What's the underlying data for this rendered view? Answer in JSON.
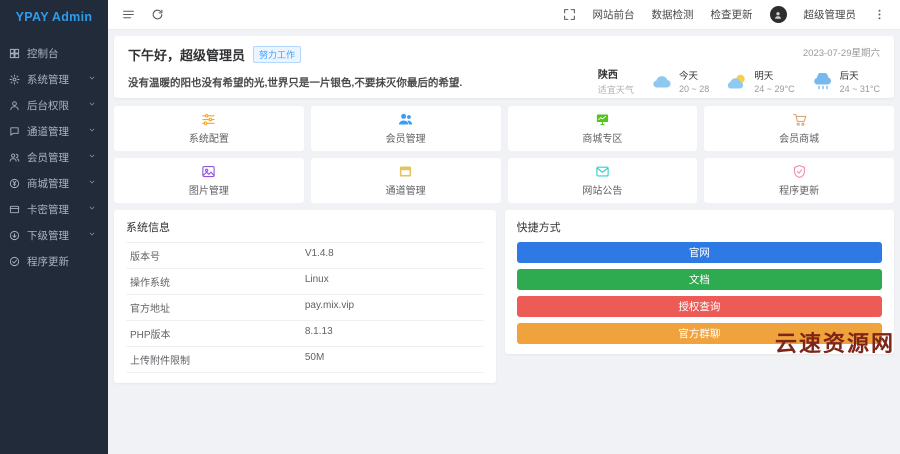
{
  "app": {
    "logo": "YPAY Admin"
  },
  "sidebar": {
    "items": [
      {
        "id": "dashboard",
        "label": "控制台",
        "icon": "dashboard-icon",
        "expandable": false
      },
      {
        "id": "system",
        "label": "系统管理",
        "icon": "gear-icon",
        "expandable": true
      },
      {
        "id": "admin-perms",
        "label": "后台权限",
        "icon": "user-icon",
        "expandable": true
      },
      {
        "id": "channel",
        "label": "通道管理",
        "icon": "chat-icon",
        "expandable": true
      },
      {
        "id": "member",
        "label": "会员管理",
        "icon": "users-icon",
        "expandable": true
      },
      {
        "id": "mall",
        "label": "商城管理",
        "icon": "yen-circle-icon",
        "expandable": true
      },
      {
        "id": "card-keys",
        "label": "卡密管理",
        "icon": "card-icon",
        "expandable": true
      },
      {
        "id": "subordinate",
        "label": "下级管理",
        "icon": "arrow-down-circle-icon",
        "expandable": true
      },
      {
        "id": "update",
        "label": "程序更新",
        "icon": "check-circle-icon",
        "expandable": false
      }
    ]
  },
  "topbar": {
    "links": [
      "网站前台",
      "数据检测",
      "检查更新"
    ],
    "user": "超级管理员"
  },
  "greeting": {
    "title": "下午好，超级管理员",
    "badge": "努力工作",
    "quote": "没有温暖的阳也没有希望的光,世界只是一片银色,不要抹灭你最后的希望.",
    "date": "2023-07-29星期六"
  },
  "weather": {
    "location": "陕西",
    "condition": "适宜天气",
    "days": [
      {
        "label": "今天",
        "temp": "20 ~ 28",
        "icon": "cloud-icon"
      },
      {
        "label": "明天",
        "temp": "24 ~ 29°C",
        "icon": "sun-cloud-icon"
      },
      {
        "label": "后天",
        "temp": "24 ~ 31°C",
        "icon": "rain-cloud-icon"
      }
    ]
  },
  "cards": [
    {
      "label": "系统配置",
      "icon": "sliders-icon",
      "color": "#f5a623"
    },
    {
      "label": "会员管理",
      "icon": "users-fill-icon",
      "color": "#3b9cf5"
    },
    {
      "label": "商城专区",
      "icon": "board-icon",
      "color": "#52c41a"
    },
    {
      "label": "会员商城",
      "icon": "cart-icon",
      "color": "#d8a878"
    },
    {
      "label": "图片管理",
      "icon": "image-icon",
      "color": "#9254de"
    },
    {
      "label": "通道管理",
      "icon": "window-icon",
      "color": "#e6c35c"
    },
    {
      "label": "网站公告",
      "icon": "mail-icon",
      "color": "#36cfc9"
    },
    {
      "label": "程序更新",
      "icon": "shield-check-icon",
      "color": "#f48fb1"
    }
  ],
  "system_info": {
    "title": "系统信息",
    "rows": [
      {
        "label": "版本号",
        "value": "V1.4.8"
      },
      {
        "label": "操作系统",
        "value": "Linux"
      },
      {
        "label": "官方地址",
        "value": "pay.mix.vip"
      },
      {
        "label": "PHP版本",
        "value": "8.1.13"
      },
      {
        "label": "上传附件限制",
        "value": "50M"
      }
    ]
  },
  "shortcuts": {
    "title": "快捷方式",
    "buttons": [
      {
        "label": "官网",
        "color": "#2d7ae5"
      },
      {
        "label": "文档",
        "color": "#2eab50"
      },
      {
        "label": "授权查询",
        "color": "#ec5b56"
      },
      {
        "label": "官方群聊",
        "color": "#f0a23c"
      }
    ]
  },
  "watermark": "云速资源网"
}
